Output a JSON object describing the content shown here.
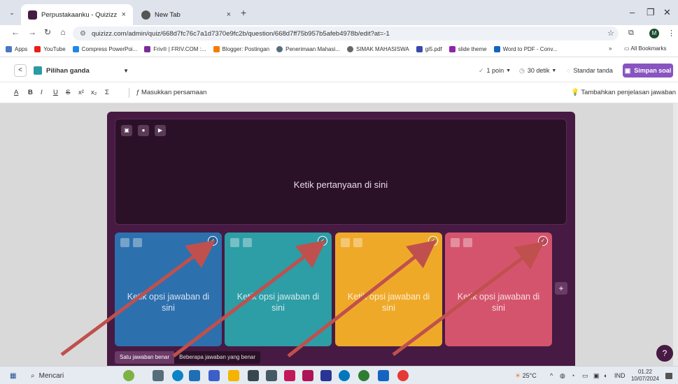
{
  "browser": {
    "tabs": [
      {
        "title": "Perpustakaanku - Quizizz",
        "close": "×"
      },
      {
        "title": "New Tab",
        "close": "×"
      }
    ],
    "new_tab": "+",
    "url": "quizizz.com/admin/quiz/668d7fc76c7a1d7370e9fc2b/question/668d7ff75b957b5afeb4978b/edit?at=-1",
    "avatar_letter": "M",
    "bookmarks": [
      "Apps",
      "YouTube",
      "Compress PowerPoi...",
      "Friv® | FRIV.COM :...",
      "Blogger: Postingan",
      "Penerimaan Mahasi...",
      "SIMAK MAHASISWA",
      "gi5.pdf",
      "slide theme",
      "Word to PDF - Conv..."
    ],
    "bookmarks_more": "»",
    "all_bookmarks": "All Bookmarks"
  },
  "toolbar": {
    "back": "<",
    "question_type": "Pilihan ganda",
    "points": "1 poin",
    "time": "30 detik",
    "standard": "Standar tanda",
    "save": "Simpan soal"
  },
  "format": {
    "buttons": [
      "A",
      "B",
      "I",
      "U",
      "S",
      "x²",
      "x₂",
      "Σ"
    ],
    "equation": "Masukkan persamaan",
    "explanation": "Tambahkan penjelasan jawaban"
  },
  "question": {
    "placeholder": "Ketik pertanyaan di sini"
  },
  "options": [
    {
      "text": "Ketik opsi jawaban di sini",
      "color": "#2d70ae"
    },
    {
      "text": "Ketik opsi jawaban di sini",
      "color": "#2d9da6"
    },
    {
      "text": "Ketik opsi jawaban di sini",
      "color": "#efa929"
    },
    {
      "text": "Ketik opsi jawaban di sini",
      "color": "#d5546d"
    }
  ],
  "answer_mode": {
    "single": "Satu jawaban benar",
    "multiple": "Beberapa jawaban yang benar"
  },
  "help": "?",
  "taskbar": {
    "search": "Mencari",
    "temperature": "25°C",
    "language": "IND",
    "time": "01.22",
    "date": "10/07/2024"
  },
  "colors": {
    "brand": "#8854c0",
    "card_bg": "#461a42",
    "question_bg": "#2b1128",
    "arrow": "#c0504d"
  }
}
